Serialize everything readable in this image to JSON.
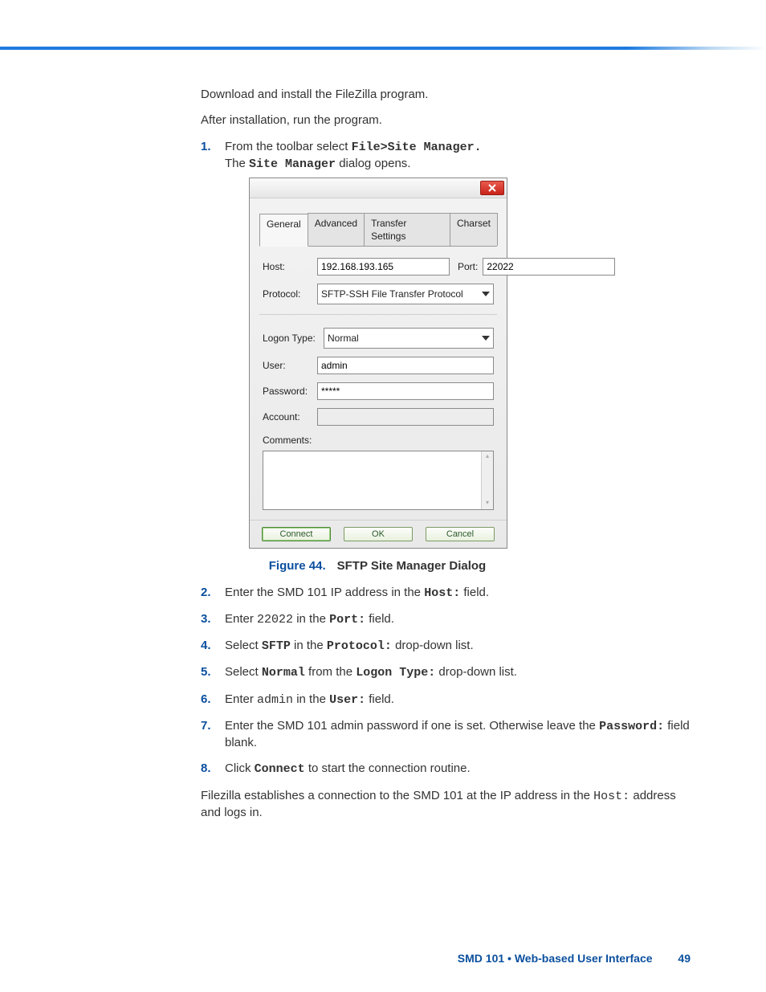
{
  "intro": {
    "p1": "Download and install the FileZilla program.",
    "p2": "After installation, run the program."
  },
  "steps": {
    "s1_a": "From the toolbar select ",
    "s1_code": "File>Site Manager.",
    "s1_b": "The ",
    "s1_bold": "Site Manager",
    "s1_c": " dialog opens.",
    "s2_a": "Enter the SMD 101 IP address in the ",
    "s2_code": "Host:",
    "s2_b": " field.",
    "s3_a": "Enter ",
    "s3_mono": "22022",
    "s3_b": " in the ",
    "s3_code": "Port:",
    "s3_c": " field.",
    "s4_a": "Select ",
    "s4_code1": "SFTP",
    "s4_b": " in the ",
    "s4_code2": "Protocol:",
    "s4_c": " drop-down list.",
    "s5_a": "Select ",
    "s5_code1": "Normal",
    "s5_b": " from the ",
    "s5_code2": "Logon Type:",
    "s5_c": " drop-down list.",
    "s6_a": "Enter ",
    "s6_mono": "admin",
    "s6_b": " in the ",
    "s6_code": "User:",
    "s6_c": " field.",
    "s7_a": "Enter the SMD 101 admin password if one is set. Otherwise leave the ",
    "s7_code": "Password:",
    "s7_b": " field blank.",
    "s8_a": "Click ",
    "s8_code": "Connect",
    "s8_b": " to start the connection routine."
  },
  "outro": {
    "a": "Filezilla establishes a connection to the SMD 101 at the IP address in the ",
    "mono": "Host:",
    "b": " address and logs in."
  },
  "figure": {
    "num": "Figure 44.",
    "title": "SFTP Site Manager Dialog"
  },
  "dialog": {
    "tabs": {
      "general": "General",
      "advanced": "Advanced",
      "transfer": "Transfer Settings",
      "charset": "Charset"
    },
    "labels": {
      "host": "Host:",
      "port": "Port:",
      "protocol": "Protocol:",
      "logon_type": "Logon Type:",
      "user": "User:",
      "password": "Password:",
      "account": "Account:",
      "comments": "Comments:"
    },
    "values": {
      "host": "192.168.193.165",
      "port": "22022",
      "protocol": "SFTP-SSH File Transfer Protocol",
      "logon_type": "Normal",
      "user": "admin",
      "password": "*****",
      "account": ""
    },
    "buttons": {
      "connect": "Connect",
      "ok": "OK",
      "cancel": "Cancel"
    }
  },
  "footer": {
    "section": "SMD 101 • Web-based User Interface",
    "page": "49"
  },
  "step_numbers": {
    "n1": "1.",
    "n2": "2.",
    "n3": "3.",
    "n4": "4.",
    "n5": "5.",
    "n6": "6.",
    "n7": "7.",
    "n8": "8."
  }
}
